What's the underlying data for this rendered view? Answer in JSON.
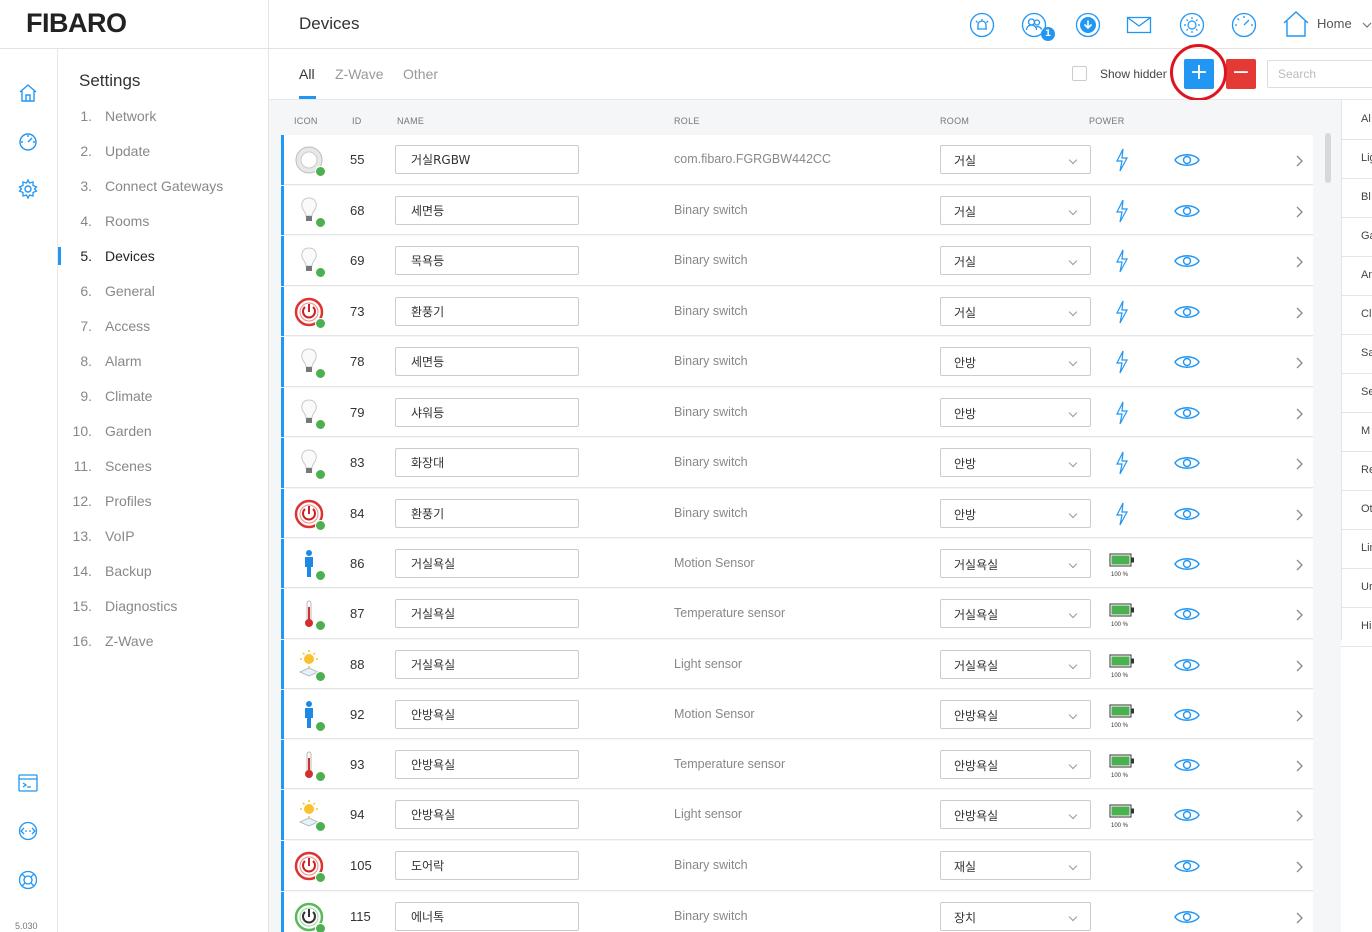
{
  "brand": {
    "logo": "FIBARO",
    "version": "5.030"
  },
  "sidebar": {
    "title": "Settings",
    "items": [
      {
        "num": "1.",
        "label": "Network"
      },
      {
        "num": "2.",
        "label": "Update"
      },
      {
        "num": "3.",
        "label": "Connect Gateways"
      },
      {
        "num": "4.",
        "label": "Rooms"
      },
      {
        "num": "5.",
        "label": "Devices",
        "active": true
      },
      {
        "num": "6.",
        "label": "General"
      },
      {
        "num": "7.",
        "label": "Access"
      },
      {
        "num": "8.",
        "label": "Alarm"
      },
      {
        "num": "9.",
        "label": "Climate"
      },
      {
        "num": "10.",
        "label": "Garden"
      },
      {
        "num": "11.",
        "label": "Scenes"
      },
      {
        "num": "12.",
        "label": "Profiles"
      },
      {
        "num": "13.",
        "label": "VoIP"
      },
      {
        "num": "14.",
        "label": "Backup"
      },
      {
        "num": "15.",
        "label": "Diagnostics"
      },
      {
        "num": "16.",
        "label": "Z-Wave"
      }
    ]
  },
  "rail": {
    "icons": [
      "home-icon",
      "dashboard-icon",
      "settings-icon",
      "terminal-icon",
      "network-icon",
      "support-icon"
    ]
  },
  "header": {
    "title": "Devices",
    "user_badge": "1",
    "home_label": "Home",
    "icons": [
      "alarm-icon",
      "users-icon",
      "download-icon",
      "mail-icon",
      "brightness-icon",
      "gauge-icon",
      "home-icon"
    ]
  },
  "tabs": [
    {
      "label": "All",
      "active": true
    },
    {
      "label": "Z-Wave"
    },
    {
      "label": "Other"
    }
  ],
  "toolbar": {
    "show_hidden": "Show hidden",
    "add_label": "+",
    "remove_label": "−",
    "search_placeholder": "Search"
  },
  "columns": {
    "icon": "ICON",
    "id": "ID",
    "name": "NAME",
    "role": "ROLE",
    "room": "ROOM",
    "power": "POWER"
  },
  "devices": [
    {
      "id": "55",
      "name": "거실RGBW",
      "role": "com.fibaro.FGRGBW442CC",
      "room": "거실",
      "icon": "rgbw-ring-icon",
      "power": "bolt"
    },
    {
      "id": "68",
      "name": "세면등",
      "role": "Binary switch",
      "room": "거실",
      "icon": "light-bulb-icon",
      "power": "bolt"
    },
    {
      "id": "69",
      "name": "목욕등",
      "role": "Binary switch",
      "room": "거실",
      "icon": "light-bulb-icon",
      "power": "bolt"
    },
    {
      "id": "73",
      "name": "환풍기",
      "role": "Binary switch",
      "room": "거실",
      "icon": "power-button-icon",
      "power": "bolt"
    },
    {
      "id": "78",
      "name": "세면등",
      "role": "Binary switch",
      "room": "안방",
      "icon": "light-bulb-icon",
      "power": "bolt"
    },
    {
      "id": "79",
      "name": "샤워등",
      "role": "Binary switch",
      "room": "안방",
      "icon": "light-bulb-icon",
      "power": "bolt"
    },
    {
      "id": "83",
      "name": "화장대",
      "role": "Binary switch",
      "room": "안방",
      "icon": "light-bulb-icon",
      "power": "bolt"
    },
    {
      "id": "84",
      "name": "환풍기",
      "role": "Binary switch",
      "room": "안방",
      "icon": "power-button-icon",
      "power": "bolt"
    },
    {
      "id": "86",
      "name": "거실욕실",
      "role": "Motion Sensor",
      "room": "거실욕실",
      "icon": "motion-person-icon",
      "power": "battery",
      "battery": "100 %"
    },
    {
      "id": "87",
      "name": "거실욕실",
      "role": "Temperature sensor",
      "room": "거실욕실",
      "icon": "thermometer-icon",
      "power": "battery",
      "battery": "100 %"
    },
    {
      "id": "88",
      "name": "거실욕실",
      "role": "Light sensor",
      "room": "거실욕실",
      "icon": "sun-sensor-icon",
      "power": "battery",
      "battery": "100 %"
    },
    {
      "id": "92",
      "name": "안방욕실",
      "role": "Motion Sensor",
      "room": "안방욕실",
      "icon": "motion-person-icon",
      "power": "battery",
      "battery": "100 %"
    },
    {
      "id": "93",
      "name": "안방욕실",
      "role": "Temperature sensor",
      "room": "안방욕실",
      "icon": "thermometer-icon",
      "power": "battery",
      "battery": "100 %"
    },
    {
      "id": "94",
      "name": "안방욕실",
      "role": "Light sensor",
      "room": "안방욕실",
      "icon": "sun-sensor-icon",
      "power": "battery",
      "battery": "100 %"
    },
    {
      "id": "105",
      "name": "도어락",
      "role": "Binary switch",
      "room": "재실",
      "icon": "power-button-icon",
      "power": "none"
    },
    {
      "id": "115",
      "name": "에너톡",
      "role": "Binary switch",
      "room": "장치",
      "icon": "power-button-green-icon",
      "power": "none"
    }
  ],
  "right_panel": {
    "items": [
      "Al",
      "Lig",
      "Bl",
      "Ga",
      "An",
      "Cl",
      "Sa",
      "Se",
      "M",
      "Re",
      "Ot",
      "Lin",
      "Ur",
      "Hi"
    ]
  },
  "colors": {
    "accent": "#2196f3",
    "danger": "#e53935",
    "ok": "#4caf50",
    "annotation": "#e0141e"
  }
}
